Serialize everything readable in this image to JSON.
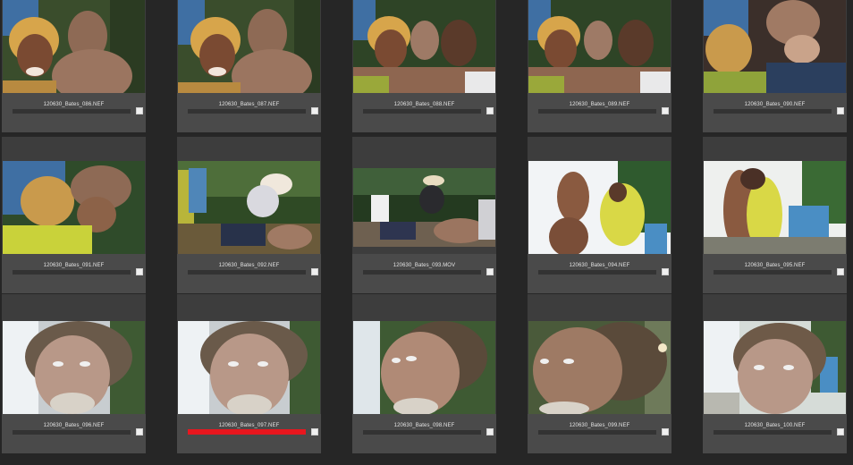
{
  "browser": {
    "thumbnails": [
      {
        "filename": "120630_Bates_086.NEF",
        "label_color": "none"
      },
      {
        "filename": "120630_Bates_087.NEF",
        "label_color": "none"
      },
      {
        "filename": "120630_Bates_088.NEF",
        "label_color": "none"
      },
      {
        "filename": "120630_Bates_089.NEF",
        "label_color": "none"
      },
      {
        "filename": "120630_Bates_090.NEF",
        "label_color": "none"
      },
      {
        "filename": "120630_Bates_091.NEF",
        "label_color": "none"
      },
      {
        "filename": "120630_Bates_092.NEF",
        "label_color": "none"
      },
      {
        "filename": "120630_Bates_093.MOV",
        "label_color": "none"
      },
      {
        "filename": "120630_Bates_094.NEF",
        "label_color": "none"
      },
      {
        "filename": "120630_Bates_095.NEF",
        "label_color": "none"
      },
      {
        "filename": "120630_Bates_096.NEF",
        "label_color": "none"
      },
      {
        "filename": "120630_Bates_097.NEF",
        "label_color": "#e8161e"
      },
      {
        "filename": "120630_Bates_098.NEF",
        "label_color": "none"
      },
      {
        "filename": "120630_Bates_099.NEF",
        "label_color": "none"
      },
      {
        "filename": "120630_Bates_100.NEF",
        "label_color": "none"
      }
    ]
  }
}
